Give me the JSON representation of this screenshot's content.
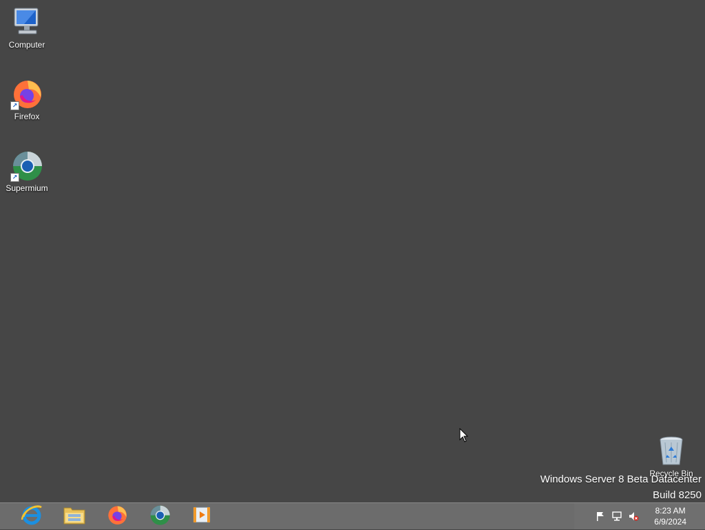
{
  "desktop": {
    "icons": [
      {
        "label": "Computer",
        "icon": "computer-icon"
      },
      {
        "label": "Firefox",
        "icon": "firefox-icon"
      },
      {
        "label": "Supermium",
        "icon": "supermium-icon"
      },
      {
        "label": "Recycle Bin",
        "icon": "recycle-bin-icon"
      }
    ],
    "background_color": "#464646"
  },
  "watermark": {
    "line1": "Windows Server 8 Beta Datacenter",
    "line2": "Build 8250"
  },
  "taskbar": {
    "pinned": [
      {
        "name": "internet-explorer",
        "icon": "internet-explorer-icon"
      },
      {
        "name": "file-explorer",
        "icon": "folder-icon"
      },
      {
        "name": "firefox",
        "icon": "firefox-icon"
      },
      {
        "name": "supermium",
        "icon": "supermium-icon"
      },
      {
        "name": "media-player",
        "icon": "media-player-icon"
      }
    ],
    "tray": {
      "icons": [
        "action-center-flag-icon",
        "network-icon",
        "volume-muted-icon"
      ],
      "time": "8:23 AM",
      "date": "6/9/2024"
    }
  }
}
